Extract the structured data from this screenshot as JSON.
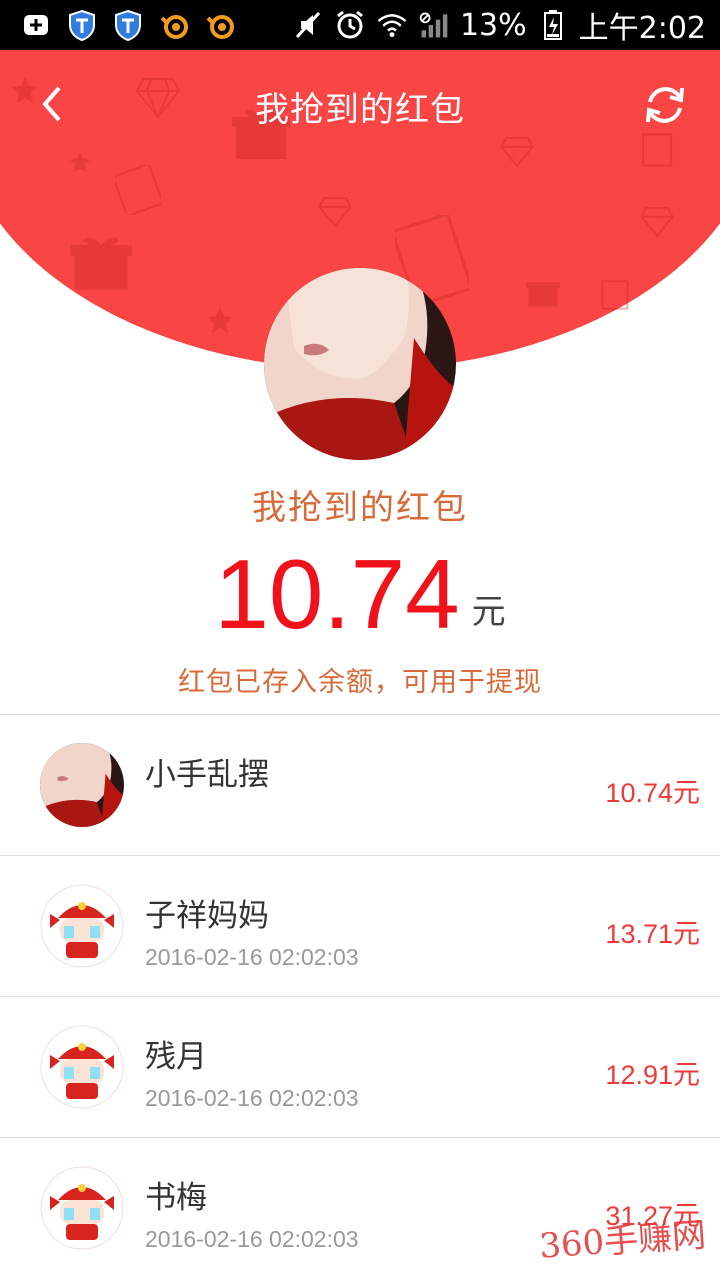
{
  "status_bar": {
    "battery": "13%",
    "time": "上午2:02",
    "icons": [
      "add-box-icon",
      "shield-icon",
      "shield-icon",
      "squirrel-icon",
      "squirrel-icon",
      "mute-icon",
      "alarm-icon",
      "wifi-icon",
      "signal-icon",
      "battery-icon"
    ]
  },
  "header": {
    "title": "我抢到的红包",
    "back_icon": "chevron-left-icon",
    "refresh_icon": "refresh-icon"
  },
  "summary": {
    "title": "我抢到的红包",
    "amount": "10.74",
    "unit": "元",
    "note": "红包已存入余额，可用于提现"
  },
  "list": {
    "items": [
      {
        "name": "小手乱摆",
        "time": "",
        "amount": "10.74元",
        "avatar": "photo"
      },
      {
        "name": "子祥妈妈",
        "time": "2016-02-16 02:02:03",
        "amount": "13.71元",
        "avatar": "cartoon"
      },
      {
        "name": "残月",
        "time": "2016-02-16 02:02:03",
        "amount": "12.91元",
        "avatar": "cartoon"
      },
      {
        "name": "书梅",
        "time": "2016-02-16 02:02:03",
        "amount": "31.27元",
        "avatar": "cartoon"
      }
    ]
  },
  "watermark": "360手赚网",
  "colors": {
    "header_red": "#fa4545",
    "amount_red": "#f0121b",
    "accent_orange": "#d86a3a"
  }
}
